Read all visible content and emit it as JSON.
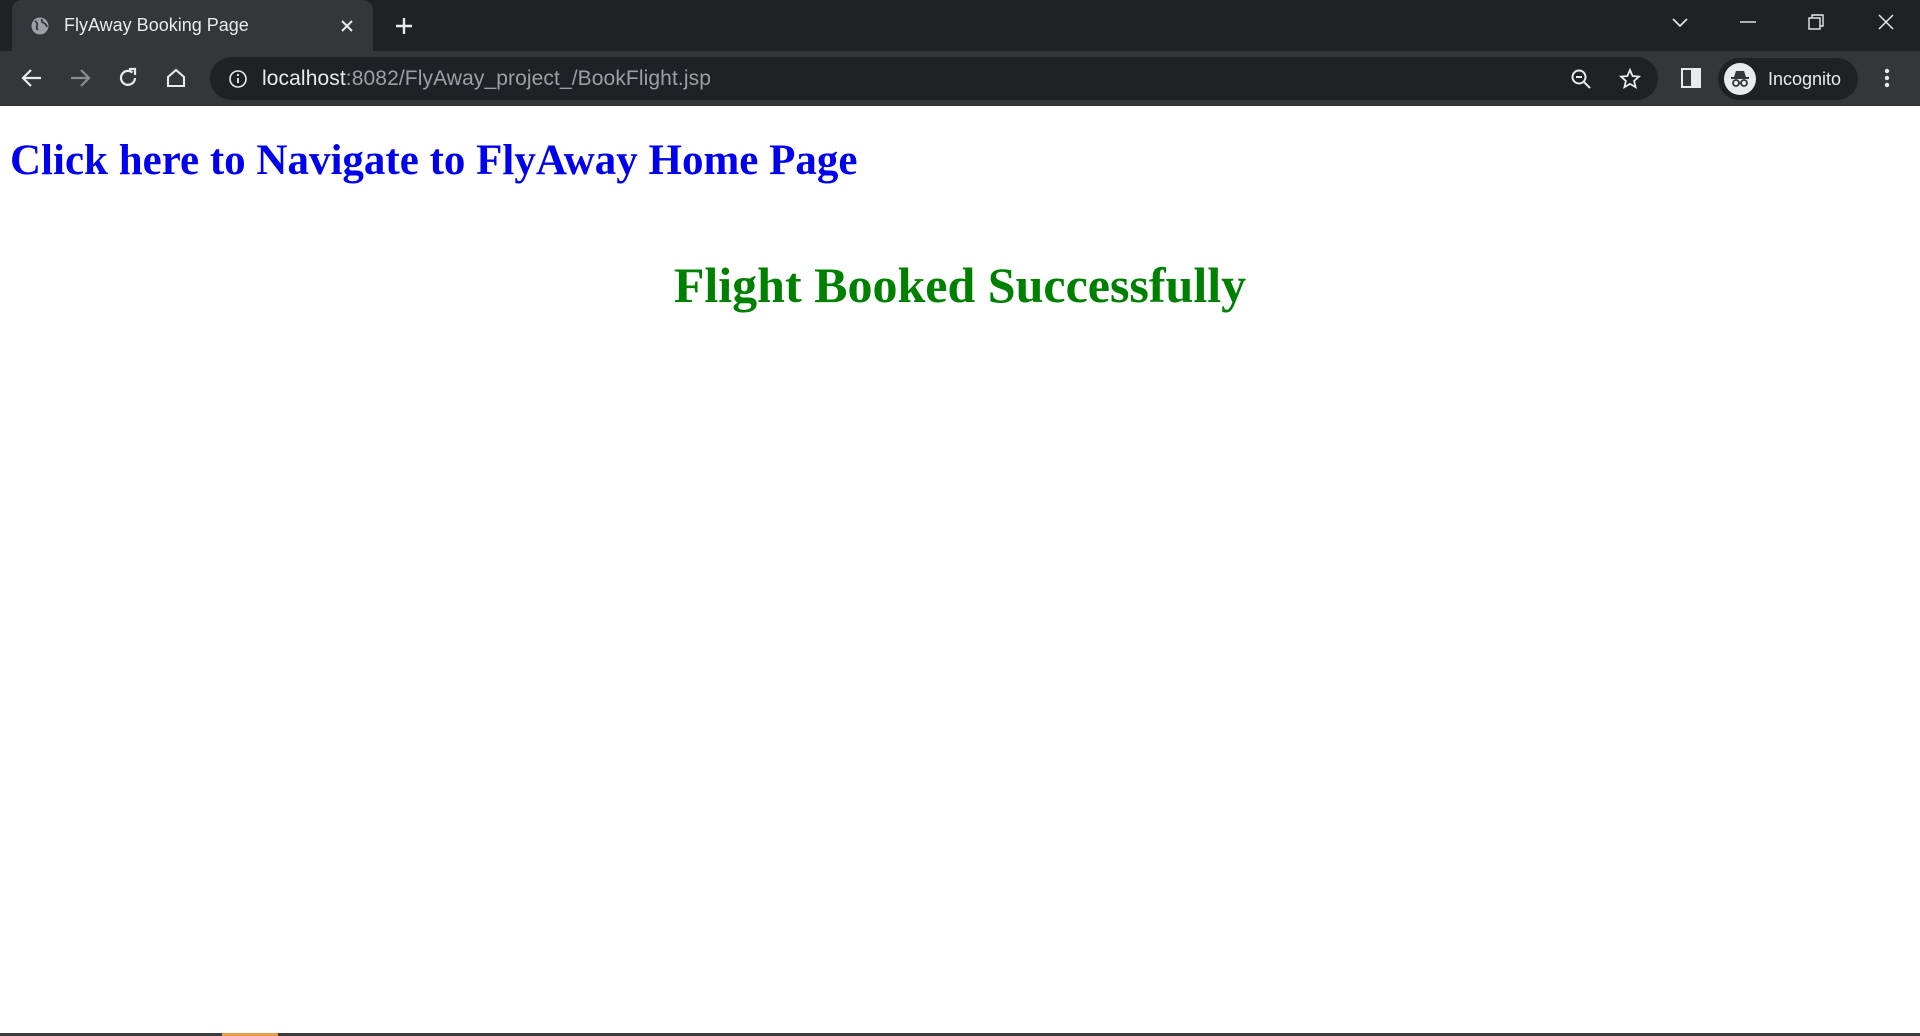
{
  "browser": {
    "tab": {
      "title": "FlyAway Booking Page"
    },
    "address": {
      "host": "localhost",
      "path": ":8082/FlyAway_project_/BookFlight.jsp"
    },
    "profile": {
      "label": "Incognito"
    }
  },
  "page": {
    "home_link": "Click here to Navigate to FlyAway Home Page",
    "status_message": "Flight Booked Successfully"
  },
  "colors": {
    "chrome_dark": "#202124",
    "chrome_tab": "#35363a",
    "link": "#0000ee",
    "success": "#008000"
  },
  "icons": [
    "globe-icon",
    "close-icon",
    "plus-icon",
    "chevron-down-icon",
    "minimize-icon",
    "restore-icon",
    "window-close-icon",
    "back-arrow-icon",
    "forward-arrow-icon",
    "reload-icon",
    "home-icon",
    "info-icon",
    "zoom-out-icon",
    "star-icon",
    "side-panel-icon",
    "incognito-icon",
    "kebab-menu-icon"
  ]
}
